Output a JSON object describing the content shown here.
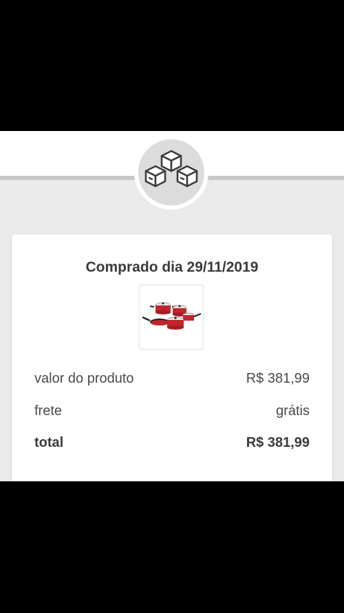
{
  "order": {
    "title": "Comprado dia 29/11/2019",
    "product_image": "cookware-set-red",
    "rows": [
      {
        "label": "valor do produto",
        "value": "R$ 381,99"
      },
      {
        "label": "frete",
        "value": "grátis"
      },
      {
        "label": "total",
        "value": "R$ 381,99"
      }
    ]
  },
  "icons": {
    "header_icon": "boxes-icon"
  },
  "colors": {
    "header_bg": "#ffffff",
    "content_bg": "#ebebeb",
    "divider": "#c8c8c8",
    "icon_circle": "#dcdcdc",
    "text": "#4a4a4a"
  }
}
